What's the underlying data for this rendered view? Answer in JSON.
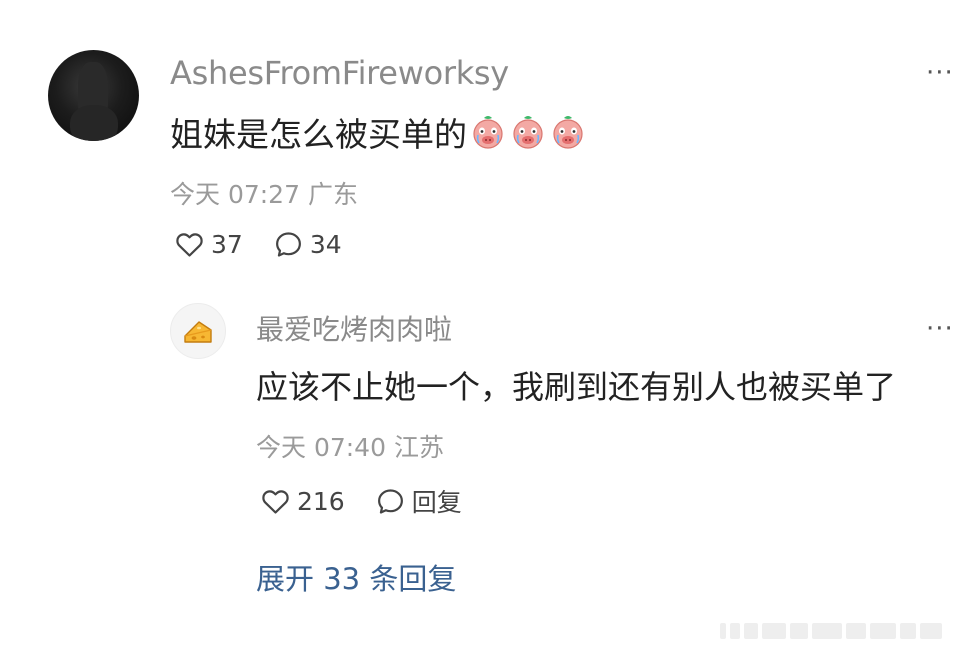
{
  "comment": {
    "username": "AshesFromFireworksy",
    "text": "姐妹是怎么被买单的",
    "emoji": "crying-pig-face-emoji",
    "emoji_count": 3,
    "time": "今天 07:27",
    "location": "广东",
    "likes": "37",
    "replies": "34",
    "more_label": "···"
  },
  "reply": {
    "username": "最爱吃烤肉肉啦",
    "text": "应该不止她一个，我刷到还有别人也被买单了",
    "time": "今天 07:40",
    "location": "江苏",
    "likes": "216",
    "reply_label": "回复",
    "more_label": "···",
    "avatar_icon": "cheese-icon"
  },
  "expand_replies": "展开 33 条回复",
  "colors": {
    "username": "#8a8a8a",
    "body_text": "#222222",
    "meta_text": "#9a9a9a",
    "link": "#3a6190"
  }
}
